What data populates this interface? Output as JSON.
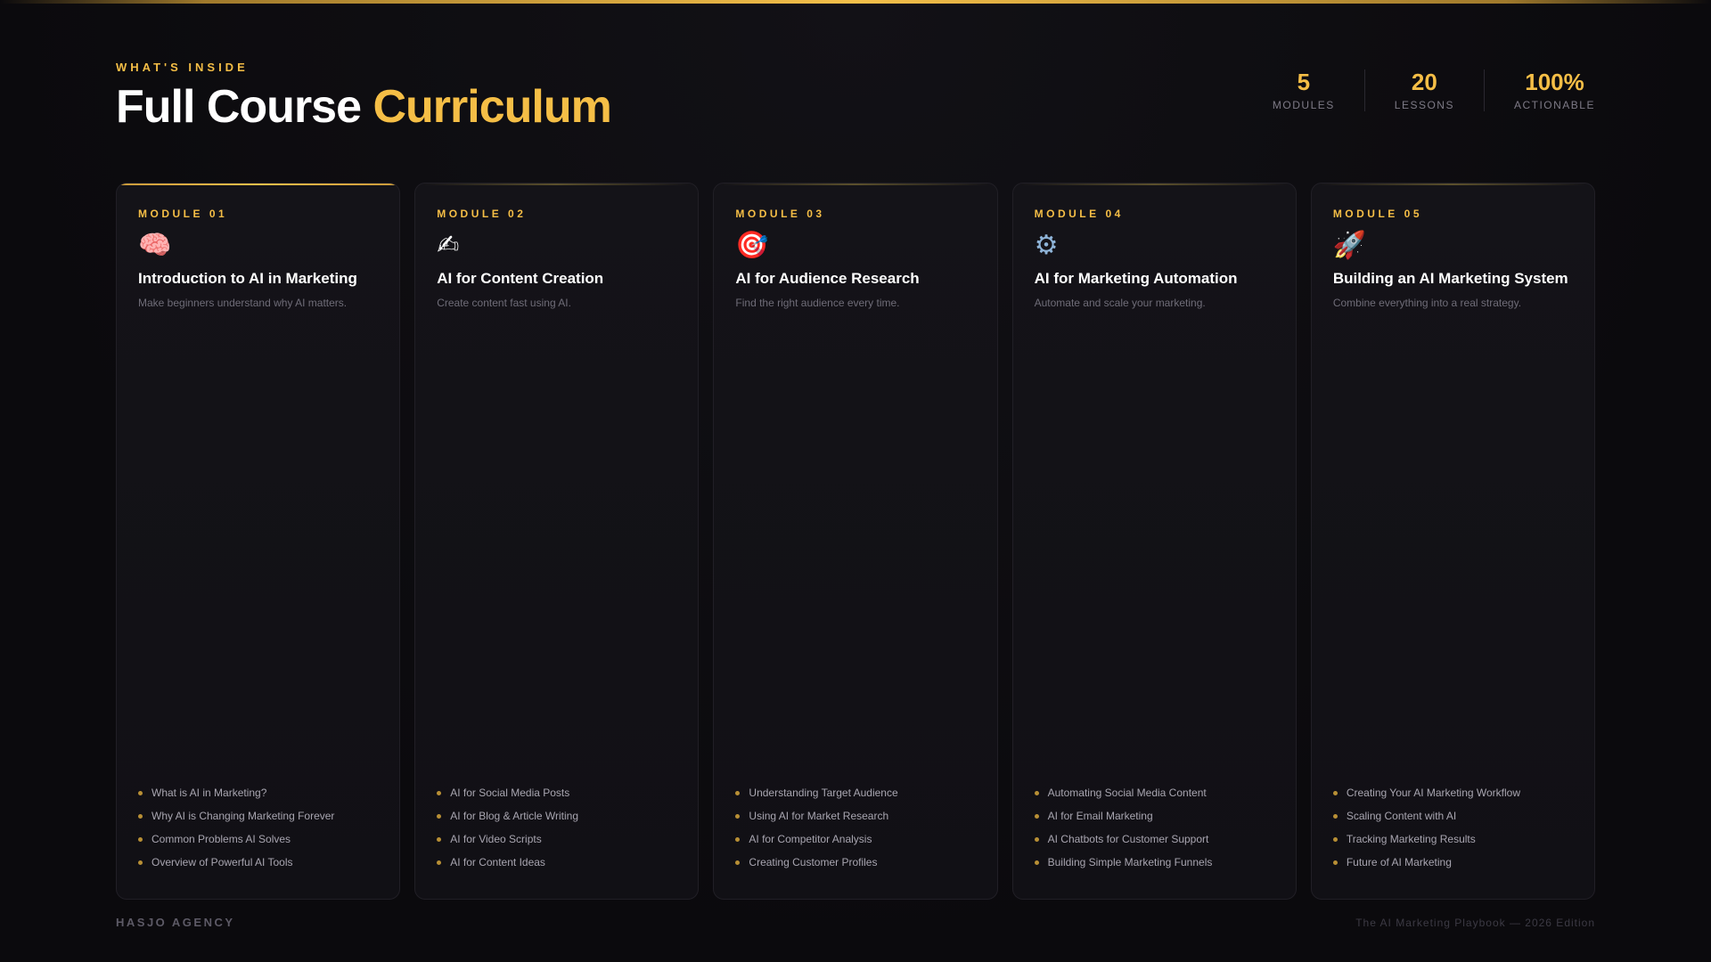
{
  "header": {
    "eyebrow": "WHAT'S INSIDE",
    "title_main": "Full Course",
    "title_accent": "Curriculum"
  },
  "stats": [
    {
      "value": "5",
      "label": "MODULES"
    },
    {
      "value": "20",
      "label": "LESSONS"
    },
    {
      "value": "100%",
      "label": "ACTIONABLE"
    }
  ],
  "modules": [
    {
      "label": "MODULE 01",
      "icon": "brain-icon",
      "icon_glyph": "🧠",
      "title": "Introduction to AI in Marketing",
      "description": "Make beginners understand why AI matters.",
      "lessons": [
        "What is AI in Marketing?",
        "Why AI is Changing Marketing Forever",
        "Common Problems AI Solves",
        "Overview of Powerful AI Tools"
      ]
    },
    {
      "label": "MODULE 02",
      "icon": "writing-hand-icon",
      "icon_glyph": "✍",
      "title": "AI for Content Creation",
      "description": "Create content fast using AI.",
      "lessons": [
        "AI for Social Media Posts",
        "AI for Blog & Article Writing",
        "AI for Video Scripts",
        "AI for Content Ideas"
      ]
    },
    {
      "label": "MODULE 03",
      "icon": "target-icon",
      "icon_glyph": "🎯",
      "title": "AI for Audience Research",
      "description": "Find the right audience every time.",
      "lessons": [
        "Understanding Target Audience",
        "Using AI for Market Research",
        "AI for Competitor Analysis",
        "Creating Customer Profiles"
      ]
    },
    {
      "label": "MODULE 04",
      "icon": "gear-icon",
      "icon_glyph": "⚙",
      "title": "AI for Marketing Automation",
      "description": "Automate and scale your marketing.",
      "lessons": [
        "Automating Social Media Content",
        "AI for Email Marketing",
        "AI Chatbots for Customer Support",
        "Building Simple Marketing Funnels"
      ]
    },
    {
      "label": "MODULE 05",
      "icon": "rocket-icon",
      "icon_glyph": "🚀",
      "title": "Building an AI Marketing System",
      "description": "Combine everything into a real strategy.",
      "lessons": [
        "Creating Your AI Marketing Workflow",
        "Scaling Content with AI",
        "Tracking Marketing Results",
        "Future of AI Marketing"
      ]
    }
  ],
  "footer": {
    "brand": "HASJO AGENCY",
    "edition": "The AI Marketing Playbook — 2026 Edition"
  },
  "colors": {
    "accent": "#f5be46",
    "background": "#0c0b0e",
    "card": "#141318"
  }
}
